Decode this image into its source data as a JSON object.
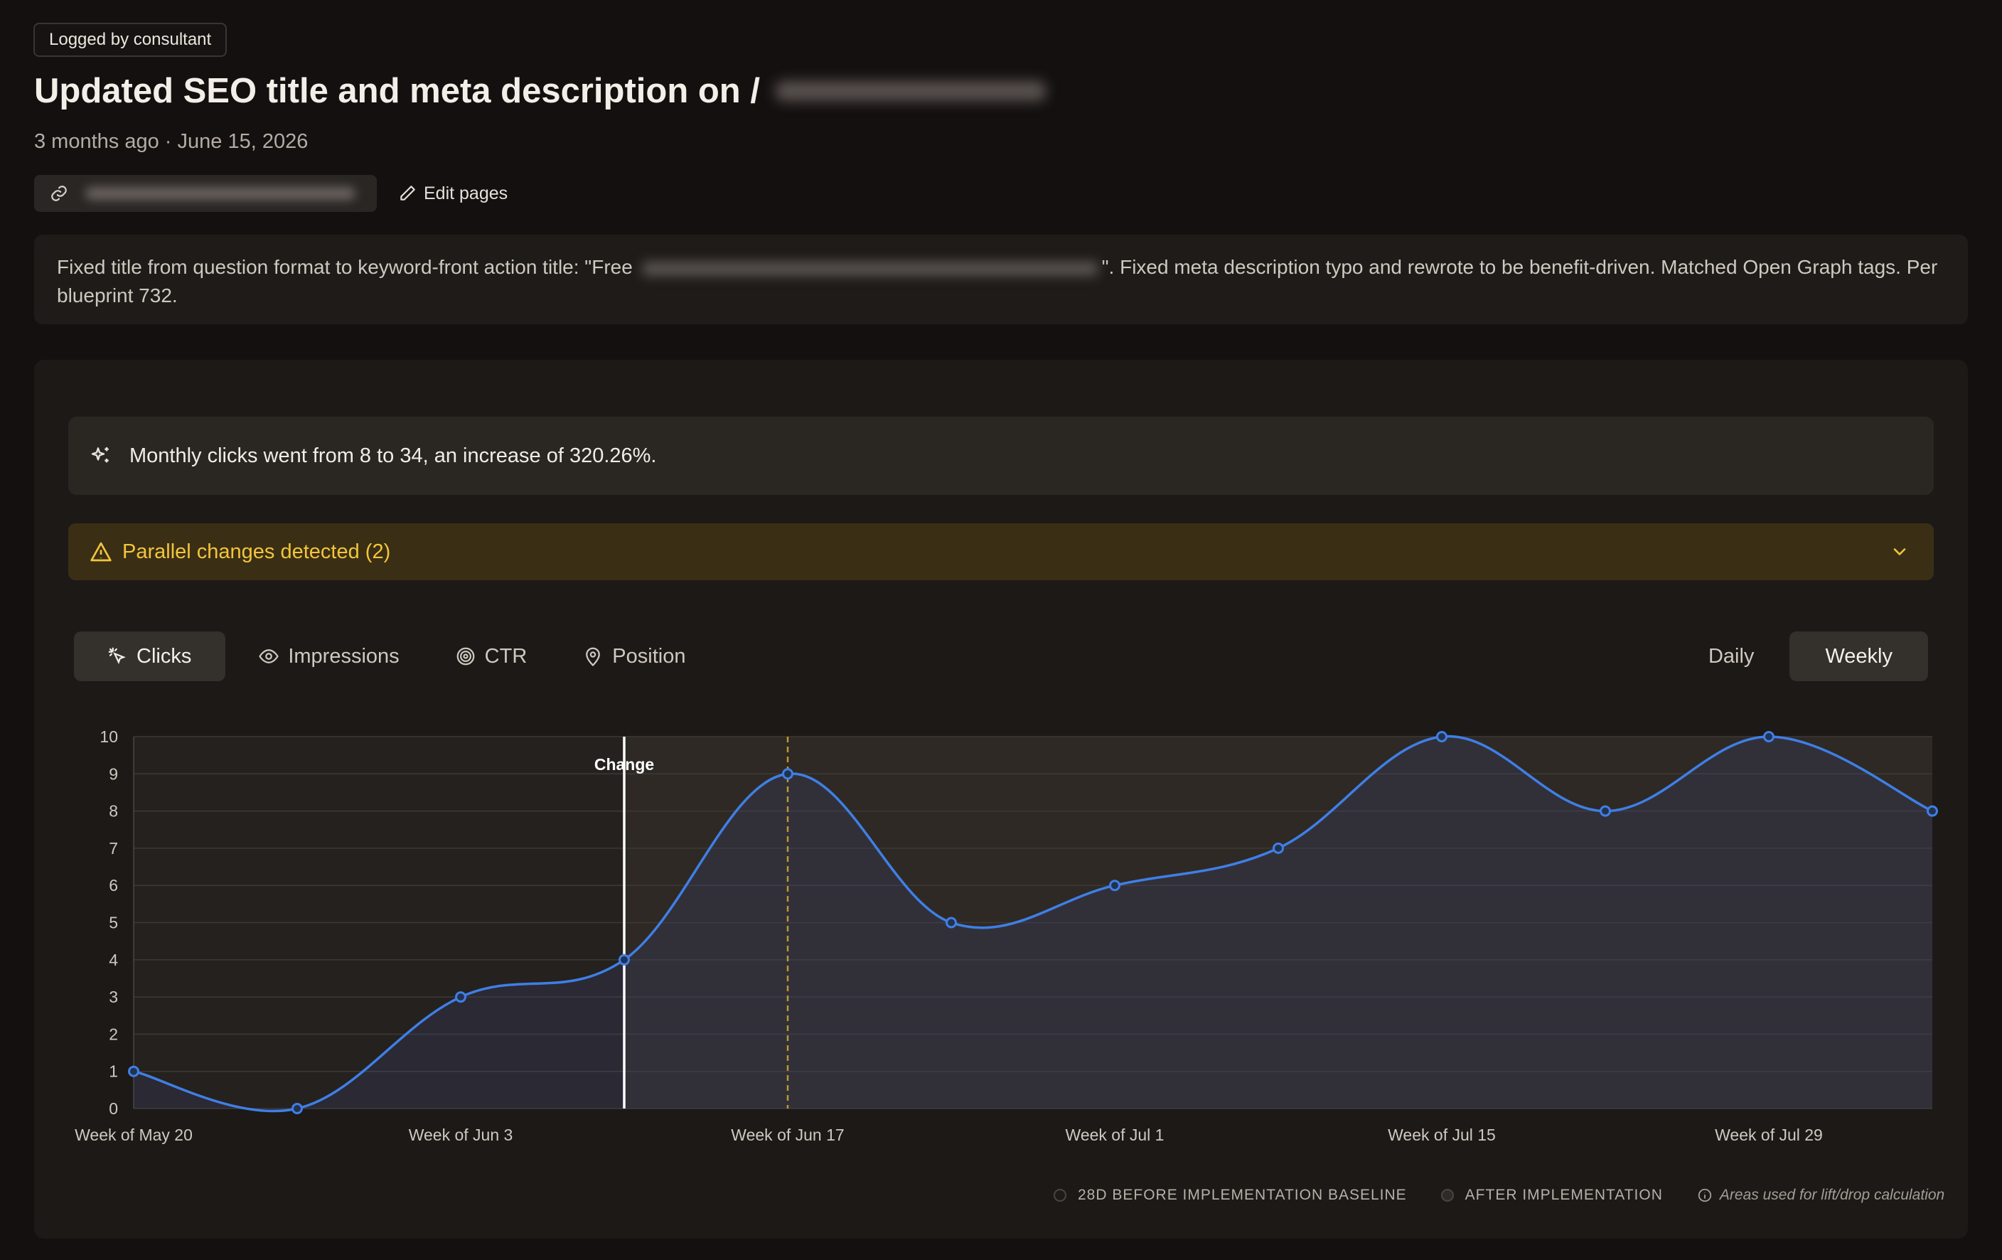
{
  "badge": "Logged by consultant",
  "title": "Updated SEO title and meta description on /",
  "meta": "3 months ago · June 15, 2026",
  "edit_pages": "Edit pages",
  "description": {
    "before": "Fixed title from question format to keyword-front action title: \"Free ",
    "after": "\". Fixed meta description typo and rewrote to be benefit-driven. Matched Open Graph tags. Per blueprint 732."
  },
  "insight": "Monthly clicks went from 8 to 34, an increase of 320.26%.",
  "warning": "Parallel changes detected (2)",
  "tabs": [
    {
      "label": "Clicks",
      "icon": "cursor-click-icon"
    },
    {
      "label": "Impressions",
      "icon": "eye-icon"
    },
    {
      "label": "CTR",
      "icon": "target-icon"
    },
    {
      "label": "Position",
      "icon": "map-pin-icon"
    }
  ],
  "toggle": {
    "daily": "Daily",
    "weekly": "Weekly"
  },
  "legend": {
    "before": "28D BEFORE IMPLEMENTATION BASELINE",
    "after": "AFTER IMPLEMENTATION",
    "note": "Areas used for lift/drop calculation"
  },
  "colors": {
    "line": "#3f7fe6",
    "warning": "#f3c53c",
    "change": "#ffffff",
    "parallel": "#b99a2e"
  },
  "chart_data": {
    "type": "line",
    "x": [
      "May 20",
      "May 27",
      "Jun 3",
      "Jun 10",
      "Jun 17",
      "Jun 24",
      "Jul 1",
      "Jul 8",
      "Jul 15",
      "Jul 22",
      "Jul 29",
      "Aug 5"
    ],
    "tick_labels": [
      "Week of May 20",
      "Week of Jun 3",
      "Week of Jun 17",
      "Week of Jul 1",
      "Week of Jul 15",
      "Week of Jul 29"
    ],
    "series": [
      {
        "values": [
          1,
          0,
          3,
          4,
          9,
          5,
          6,
          7,
          10,
          8,
          10,
          8
        ]
      }
    ],
    "ylim": [
      0,
      10
    ],
    "yticks": [
      0,
      1,
      2,
      3,
      4,
      5,
      6,
      7,
      8,
      9,
      10
    ],
    "change_label": "Change",
    "change_index": 3,
    "parallel_index": 4,
    "grid": true
  }
}
